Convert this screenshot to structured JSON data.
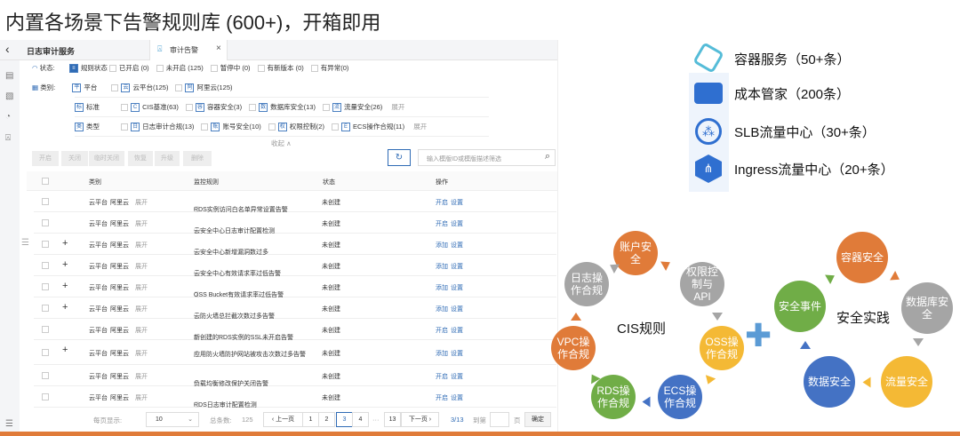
{
  "title": "内置各场景下告警规则库 (600+)，开箱即用",
  "tabbar": {
    "service": "日志审计服务",
    "tab": "审计告警",
    "close": "×",
    "back": "‹"
  },
  "filters": {
    "status_label": "状态:",
    "status_group": "规则状态",
    "status_options": [
      "已开启 (0)",
      "未开启 (125)",
      "暂停中 (0)",
      "有新版本 (0)",
      "有异常(0)"
    ],
    "category_label": "类别:",
    "platform_label": "平台",
    "platform_options": [
      "云平台(125)",
      "阿里云(125)"
    ],
    "standard_label": "标准",
    "standard_options": [
      "CIS基准(63)",
      "容器安全(3)",
      "数据库安全(13)",
      "流量安全(26)"
    ],
    "type_label": "类型",
    "type_options": [
      "日志审计合规(13)",
      "账号安全(10)",
      "权限控制(2)",
      "ECS操作合规(11)"
    ],
    "expand": "展开",
    "collapse": "收起 ∧"
  },
  "toolbar": {
    "buttons": [
      "开启",
      "关闭",
      "临时关闭",
      "恢复",
      "升级",
      "删除"
    ],
    "refresh": "↻",
    "search_placeholder": "输入模版ID或模版描述筛选"
  },
  "table": {
    "headers": [
      "类别",
      "监控规则",
      "状态",
      "操作"
    ],
    "rows": [
      {
        "plus": false,
        "cat1": "云平台",
        "cat2": "阿里云",
        "expand": "展开",
        "rule": "RDS实例访问白名单异常设置告警",
        "status": "未创建",
        "a1": "开启",
        "a2": "设置"
      },
      {
        "plus": false,
        "cat1": "云平台",
        "cat2": "阿里云",
        "expand": "展开",
        "rule": "云安全中心日志审计配置检测",
        "status": "未创建",
        "a1": "开启",
        "a2": "设置"
      },
      {
        "plus": true,
        "cat1": "云平台",
        "cat2": "阿里云",
        "expand": "展开",
        "rule": "云安全中心新增漏洞数过多",
        "status": "未创建",
        "a1": "添加",
        "a2": "设置"
      },
      {
        "plus": true,
        "cat1": "云平台",
        "cat2": "阿里云",
        "expand": "展开",
        "rule": "云安全中心有效请求率过低告警",
        "status": "未创建",
        "a1": "添加",
        "a2": "设置"
      },
      {
        "plus": true,
        "cat1": "云平台",
        "cat2": "阿里云",
        "expand": "展开",
        "rule": "OSS Bucket有效请求率过低告警",
        "status": "未创建",
        "a1": "添加",
        "a2": "设置"
      },
      {
        "plus": true,
        "cat1": "云平台",
        "cat2": "阿里云",
        "expand": "展开",
        "rule": "云防火墙总拦截次数过多告警",
        "status": "未创建",
        "a1": "添加",
        "a2": "设置"
      },
      {
        "plus": false,
        "cat1": "云平台",
        "cat2": "阿里云",
        "expand": "展开",
        "rule": "新创建的RDS实例的SSL未开启告警",
        "status": "未创建",
        "a1": "开启",
        "a2": "设置"
      },
      {
        "plus": true,
        "cat1": "云平台",
        "cat2": "阿里云",
        "expand": "展开",
        "rule": "应用防火墙防护网站被攻击次数过多告警",
        "status": "未创建",
        "a1": "添加",
        "a2": "设置"
      },
      {
        "plus": false,
        "cat1": "云平台",
        "cat2": "阿里云",
        "expand": "展开",
        "rule": "负载均衡修改保护关闭告警",
        "status": "未创建",
        "a1": "开启",
        "a2": "设置"
      },
      {
        "plus": false,
        "cat1": "云平台",
        "cat2": "阿里云",
        "expand": "展开",
        "rule": "RDS日志审计配置检测",
        "status": "未创建",
        "a1": "开启",
        "a2": "设置"
      }
    ]
  },
  "pagination": {
    "per_page_label": "每页显示:",
    "per_page": "10",
    "total_label": "总条数:",
    "total": "125",
    "prev": "‹ 上一页",
    "pages": [
      "1",
      "2",
      "3",
      "4"
    ],
    "ellipsis": "···",
    "last": "13",
    "next": "下一页 ›",
    "current": "3/13",
    "goto_label": "到第",
    "page_unit": "页",
    "confirm": "确定"
  },
  "services": [
    "容器服务（50+条）",
    "成本管家（200条）",
    "SLB流量中心（30+条）",
    "Ingress流量中心（20+条）"
  ],
  "cis": {
    "title": "CIS规则",
    "nodes": [
      "账户安全",
      "权限控制与API",
      "OSS操作合规",
      "ECS操作合规",
      "RDS操作合规",
      "VPC操作合规",
      "日志操作合规"
    ]
  },
  "practice": {
    "title": "安全实践",
    "nodes": [
      "容器安全",
      "数据库安全",
      "流量安全",
      "数据安全",
      "安全事件"
    ]
  },
  "plus": "✚",
  "colors": {
    "orange": "#e07b39",
    "gray": "#a5a5a5",
    "yellow": "#f4b935",
    "blue": "#4472c4",
    "green": "#70ad47",
    "link": "#2f6bb5"
  }
}
